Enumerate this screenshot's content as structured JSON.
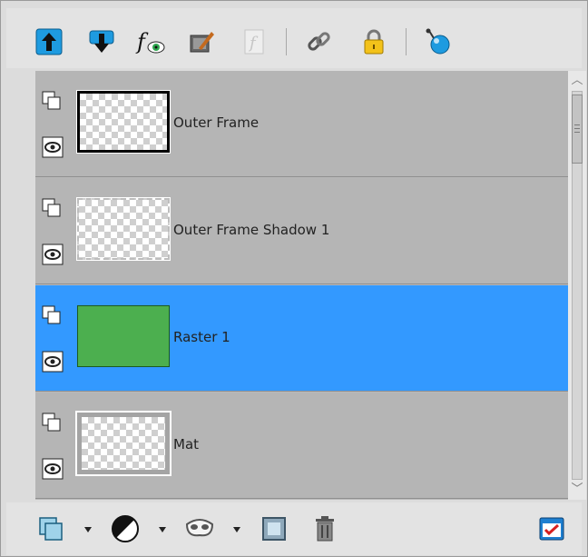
{
  "toolbar": {
    "icons": [
      "move-layer-up-icon",
      "move-layer-down-icon",
      "layer-styles-icon",
      "edit-layer-icon",
      "function-icon-disabled",
      "link-icon",
      "lock-icon",
      "bubble-icon"
    ]
  },
  "layers": [
    {
      "name": "Outer Frame",
      "selected": false,
      "thumb": "frame"
    },
    {
      "name": "Outer Frame Shadow 1",
      "selected": false,
      "thumb": "shadow"
    },
    {
      "name": "Raster 1",
      "selected": true,
      "thumb": "green"
    },
    {
      "name": "Mat",
      "selected": false,
      "thumb": "mat"
    }
  ],
  "bottombar": {
    "icons": [
      "new-raster-layer-icon",
      "new-adjustment-layer-icon",
      "new-mask-icon",
      "new-group-icon",
      "delete-layer-icon",
      "layer-properties-icon"
    ]
  },
  "colors": {
    "selected_row": "#3399ff",
    "row": "#b5b5b5",
    "accent_blue": "#1e9be0",
    "raster_green": "#4caf4f"
  }
}
